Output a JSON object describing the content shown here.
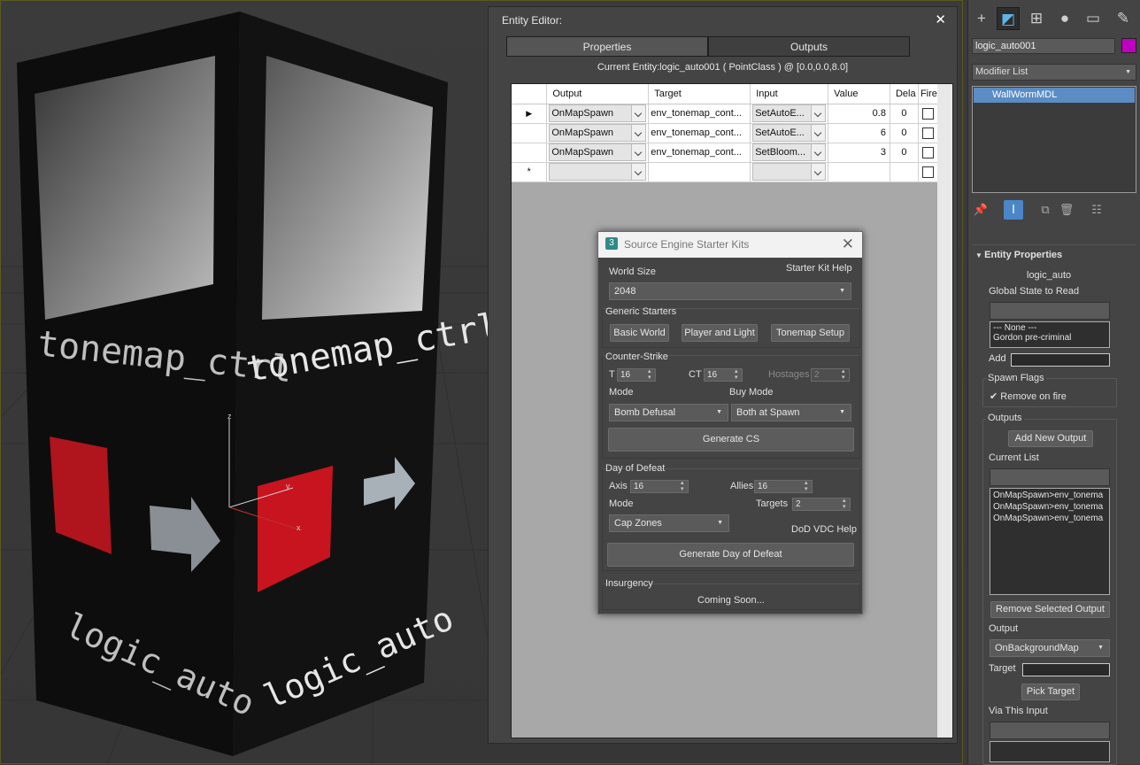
{
  "viewport": {
    "labels": [
      "tonemap_ctrl",
      "tonemap_ctrl",
      "logic_auto",
      "logic_auto"
    ],
    "axis": {
      "z": "z",
      "y": "y",
      "x": "x"
    }
  },
  "entity_editor": {
    "title": "Entity Editor:",
    "close": "✕",
    "tabs": [
      "Properties",
      "Outputs"
    ],
    "current_entity": "Current Entity:logic_auto001 ( PointClass ) @ [0.0,0.0,8.0]",
    "columns": [
      "Output",
      "Target",
      "Input",
      "Value",
      "Dela",
      "Fire"
    ],
    "rows": [
      {
        "output": "OnMapSpawn",
        "target": "env_tonemap_cont...",
        "input": "SetAutoE...",
        "value": "0.8",
        "delay": "0"
      },
      {
        "output": "OnMapSpawn",
        "target": "env_tonemap_cont...",
        "input": "SetAutoE...",
        "value": "6",
        "delay": "0"
      },
      {
        "output": "OnMapSpawn",
        "target": "env_tonemap_cont...",
        "input": "SetBloom...",
        "value": "3",
        "delay": "0"
      }
    ],
    "new_row_marker": "*"
  },
  "starter": {
    "title": "Source Engine Starter Kits",
    "logo": "3",
    "close": "✕",
    "world_size_label": "World Size",
    "help_label": "Starter Kit Help",
    "world_size_value": "2048",
    "generic": {
      "label": "Generic Starters",
      "buttons": [
        "Basic World",
        "Player and Light",
        "Tonemap Setup"
      ]
    },
    "cs": {
      "label": "Counter-Strike",
      "t_label": "T",
      "t_value": "16",
      "ct_label": "CT",
      "ct_value": "16",
      "hostages_label": "Hostages",
      "hostages_value": "2",
      "mode_label": "Mode",
      "mode_value": "Bomb Defusal",
      "buy_label": "Buy Mode",
      "buy_value": "Both at Spawn",
      "generate": "Generate CS"
    },
    "dod": {
      "label": "Day of Defeat",
      "axis_label": "Axis",
      "axis_value": "16",
      "allies_label": "Allies",
      "allies_value": "16",
      "mode_label": "Mode",
      "mode_value": "Cap Zones",
      "targets_label": "Targets",
      "targets_value": "2",
      "help": "DoD VDC Help",
      "generate": "Generate Day of Defeat"
    },
    "insurgency": {
      "label": "Insurgency",
      "coming": "Coming Soon..."
    }
  },
  "command_panel": {
    "object_name": "logic_auto001",
    "swatch_color": "#c000c0",
    "modifier_list": "Modifier List",
    "stack_item": "WallWormMDL",
    "rollout_title": "Entity Properties",
    "entity_class": "logic_auto",
    "global_state_label": "Global State to Read",
    "global_options": [
      "--- None ---",
      "Gordon pre-criminal"
    ],
    "add_label": "Add",
    "spawn_flags_label": "Spawn Flags",
    "remove_on_fire": "Remove on fire",
    "outputs_label": "Outputs",
    "add_new_output": "Add New Output",
    "current_list_label": "Current List",
    "current_list": [
      "OnMapSpawn>env_tonema",
      "OnMapSpawn>env_tonema",
      "OnMapSpawn>env_tonema"
    ],
    "remove_selected": "Remove Selected Output",
    "output_label": "Output",
    "output_value": "OnBackgroundMap",
    "target_label": "Target",
    "pick_target": "Pick Target",
    "via_input_label": "Via This Input"
  }
}
